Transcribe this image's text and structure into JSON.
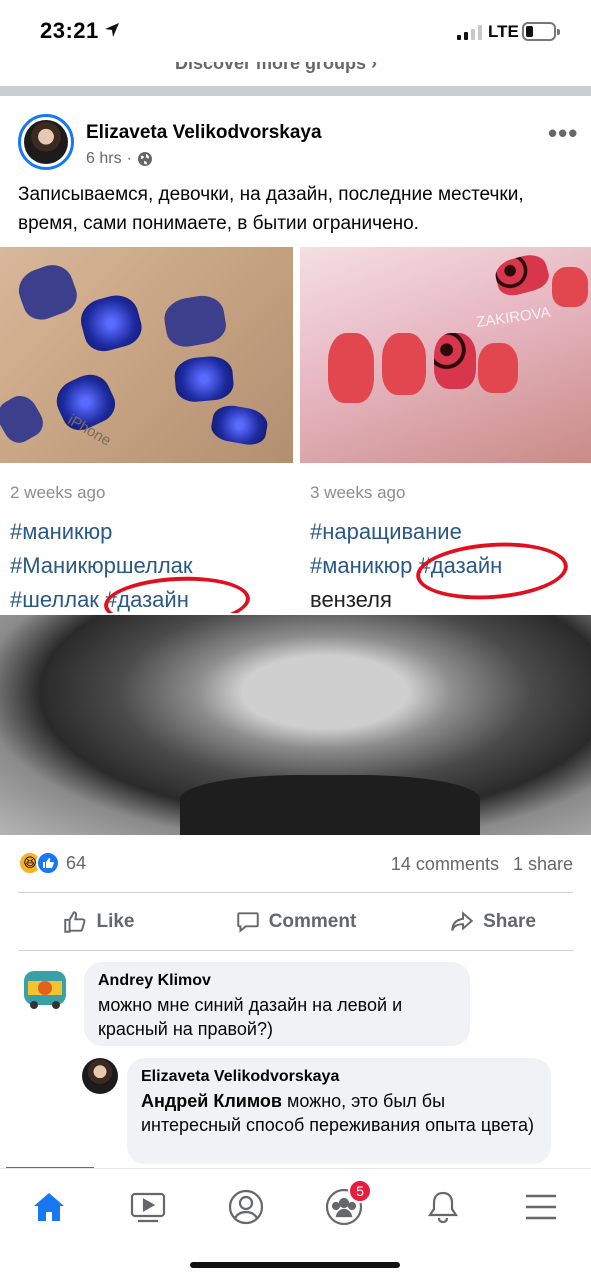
{
  "status_bar": {
    "time": "23:21",
    "network": "LTE"
  },
  "discover": {
    "label": "Discover more groups ›"
  },
  "post": {
    "author": "Elizaveta  Velikodvorskaya",
    "time": "6 hrs",
    "audience_icon": "globe-icon",
    "text": "Записываемся, девочки, на дазайн, последние местечки, время, сами понимаете, в бытии ограничено.",
    "images": {
      "left": {
        "date": "2 weeks ago",
        "tag1": "#маникюр",
        "tag2": "#Маникюршеллак",
        "tag3": "#шеллак #дазайн",
        "watermark": "iPhone"
      },
      "right": {
        "date": "3 weeks ago",
        "tag1": "#наращивание",
        "tag2": "#маникюр #дазайн",
        "tag3": "вензеля",
        "watermark": "ZAKIROVA"
      }
    },
    "reaction_count": "64",
    "comments_count": "14 comments",
    "shares_count": "1 share",
    "actions": {
      "like": "Like",
      "comment": "Comment",
      "share": "Share"
    },
    "accent": "#1877f2"
  },
  "comments": [
    {
      "author": "Andrey Klimov",
      "text": "можно мне синий дазайн на левой и красный на правой?)"
    },
    {
      "author": "Elizaveta  Velikodvorskaya",
      "mention": "Андрей Климов",
      "text": " можно, это был бы интересный способ переживания опыта цвета)"
    }
  ],
  "tabbar": {
    "groups_badge": "5",
    "icons": [
      "home-icon",
      "watch-icon",
      "profile-icon",
      "groups-icon",
      "notifications-icon",
      "menu-icon"
    ]
  }
}
